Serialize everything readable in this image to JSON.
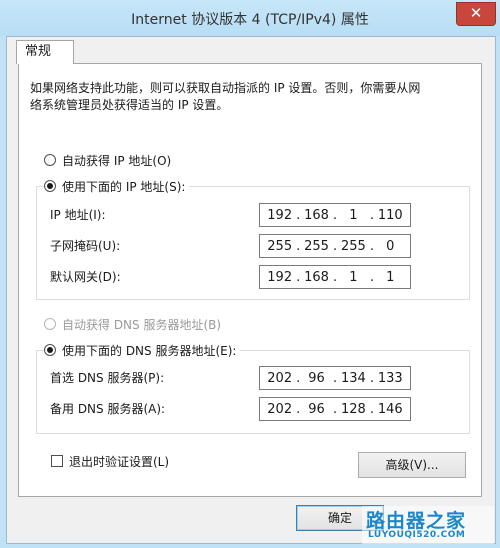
{
  "window": {
    "title": "Internet 协议版本 4 (TCP/IPv4) 属性",
    "close_glyph": "✕"
  },
  "tabs": [
    {
      "label": "常规",
      "selected": true
    }
  ],
  "description": {
    "line1": "如果网络支持此功能，则可以获取自动指派的 IP 设置。否则，你需要从网",
    "line2": "络系统管理员处获得适当的 IP 设置。"
  },
  "ip_section": {
    "auto_label": "自动获得 IP 地址(O)",
    "manual_label": "使用下面的 IP 地址(S):",
    "mode": "manual",
    "fields": [
      {
        "label": "IP 地址(I):",
        "octets": [
          "192",
          "168",
          "1",
          "110"
        ]
      },
      {
        "label": "子网掩码(U):",
        "octets": [
          "255",
          "255",
          "255",
          "0"
        ]
      },
      {
        "label": "默认网关(D):",
        "octets": [
          "192",
          "168",
          "1",
          "1"
        ]
      }
    ]
  },
  "dns_section": {
    "auto_label": "自动获得 DNS 服务器地址(B)",
    "manual_label": "使用下面的 DNS 服务器地址(E):",
    "mode": "manual",
    "fields": [
      {
        "label": "首选 DNS 服务器(P):",
        "octets": [
          "202",
          "96",
          "134",
          "133"
        ]
      },
      {
        "label": "备用 DNS 服务器(A):",
        "octets": [
          "202",
          "96",
          "128",
          "146"
        ]
      }
    ]
  },
  "validate_on_exit": {
    "label": "退出时验证设置(L)",
    "checked": false
  },
  "buttons": {
    "advanced": "高级(V)...",
    "ok": "确定"
  },
  "watermark": {
    "text_cn": "路由器之家",
    "text_en": "LUYOUQI520.COM"
  },
  "colors": {
    "title_bar": "#bfe2f7",
    "close_button": "#c8473d",
    "watermark": "#1d88c9"
  }
}
